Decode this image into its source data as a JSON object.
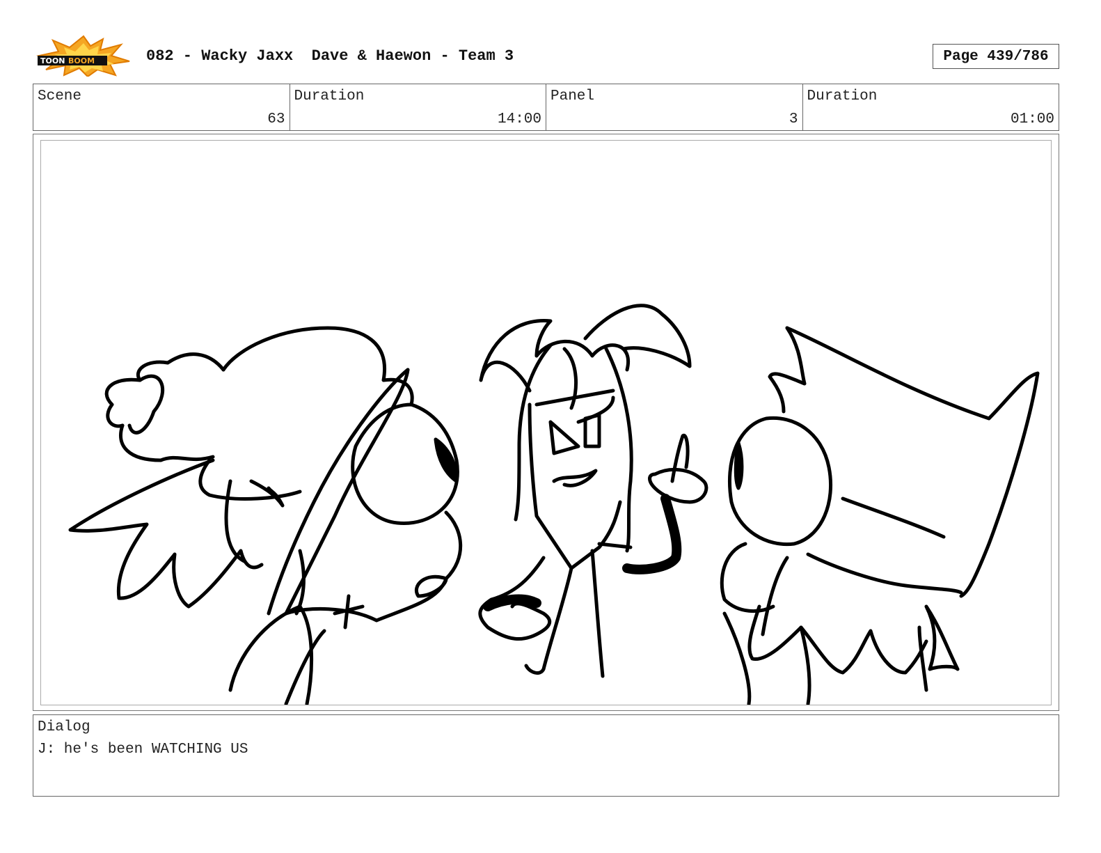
{
  "header": {
    "logo_text": "TOONBOOM",
    "title": "082 - Wacky Jaxx  Dave & Haewon - Team 3",
    "page": "Page 439/786"
  },
  "info": {
    "scene_label": "Scene",
    "scene_value": "63",
    "scene_duration_label": "Duration",
    "scene_duration_value": "14:00",
    "panel_label": "Panel",
    "panel_value": "3",
    "panel_duration_label": "Duration",
    "panel_duration_value": "01:00"
  },
  "dialog": {
    "label": "Dialog",
    "text": "J: he's been WATCHING US"
  }
}
